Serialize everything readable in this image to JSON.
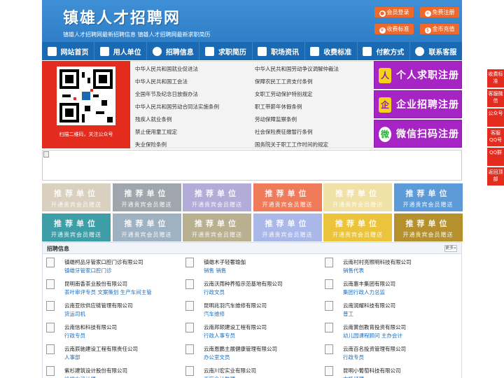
{
  "header": {
    "site_title": "镇雄人才招聘网",
    "tagline": "镇雄人才招聘网最新招聘信息    镇雄人才招聘网最新求职简历",
    "buttons": [
      {
        "label": "会员登录",
        "icon": "user-icon"
      },
      {
        "label": "免费注册",
        "icon": "register-icon"
      },
      {
        "label": "收费标准",
        "icon": "price-icon"
      },
      {
        "label": "金币充值",
        "icon": "coin-icon"
      }
    ]
  },
  "nav": {
    "items": [
      {
        "label": "网站首页",
        "icon": "home-icon"
      },
      {
        "label": "用人单位",
        "icon": "building-icon"
      },
      {
        "label": "招聘信息",
        "icon": "megaphone-icon"
      },
      {
        "label": "求职简历",
        "icon": "resume-icon"
      },
      {
        "label": "职场资讯",
        "icon": "news-icon"
      },
      {
        "label": "收费标准",
        "icon": "price-icon"
      },
      {
        "label": "付款方式",
        "icon": "card-icon"
      },
      {
        "label": "联系客服",
        "icon": "phone-icon"
      }
    ]
  },
  "qr": {
    "caption": "扫描二维码，关注公众号"
  },
  "links": {
    "left": [
      "中华人民共和国就业促进法",
      "中华人民共和国工会法",
      "全国年节及纪念日放假办法",
      "中华人民共和国劳动合同法实施条例",
      "残疾人就业条例",
      "禁止使用童工规定",
      "失业保险条例"
    ],
    "right": [
      "中华人民共和国劳动争议调解仲裁法",
      "保障农民工工资支付条例",
      "女职工劳动保护特别规定",
      "职工带薪年休假条例",
      "劳动保障监察条例",
      "社会保险费征缴暂行条例",
      "国务院关于职工工作时间的规定"
    ]
  },
  "big_buttons": [
    {
      "label": "个人求职注册",
      "icon": "person-icon",
      "color": "#a624c4"
    },
    {
      "label": "企业招聘注册",
      "icon": "enterprise-icon",
      "color": "#a624c4"
    },
    {
      "label": "微信扫码注册",
      "icon": "wechat-icon",
      "color": "#a624c4"
    }
  ],
  "recommend": {
    "line1": "推荐单位",
    "line2": "开通贵宾会员赠送",
    "colors": [
      "#d9d0c0",
      "#9fa6ad",
      "#b3acd9",
      "#f07b5b",
      "#f0e1a6",
      "#5d9bd8",
      "#3d9ea8",
      "#9fb2c2",
      "#b8b08f",
      "#a9b8e8",
      "#ecc43c",
      "#b5912e"
    ]
  },
  "jobs": {
    "title": "招聘信息",
    "more": "更多»",
    "items": [
      {
        "company": "镇雄柯品牙管家口腔门诊有限公司",
        "positions": "镇雄牙管家口腔门诊"
      },
      {
        "company": "镇雄木子轻奢瑜伽",
        "positions": "销售 销售"
      },
      {
        "company": "云南村村亮照明科技有限公司",
        "positions": "销售代表"
      },
      {
        "company": "昆明南香茶业股份有限公司",
        "positions": "茶叶审评专员 文案策划 生产车间主管"
      },
      {
        "company": "云南沃雨种养殖示范基地有限公司",
        "positions": "行政文员"
      },
      {
        "company": "云南惠丰集团有限公司",
        "positions": "集团行政人力总监"
      },
      {
        "company": "云南亚欣供应链管理有限公司",
        "positions": "货运司机"
      },
      {
        "company": "昆明兆羽汽车维修有限公司",
        "positions": "汽车维修"
      },
      {
        "company": "云南润耀科技有限公司",
        "positions": "普工"
      },
      {
        "company": "云南信和科技有限公司",
        "positions": "行政专员"
      },
      {
        "company": "云南邦颉建设工程有限公司",
        "positions": "行政人事专员"
      },
      {
        "company": "云南黉创教育投资有限公司",
        "positions": "幼儿园课程顾问 主办会计"
      },
      {
        "company": "云南辰驰建设工程有限责任公司",
        "positions": "人事部"
      },
      {
        "company": "云南恩鹏主展健康管理有限公司",
        "positions": "办公室文员"
      },
      {
        "company": "云南百名投资管理有限公司",
        "positions": "行政专员"
      },
      {
        "company": "紫杉建筑设计股份有限公司",
        "positions": "给排水设计师"
      },
      {
        "company": "云南川宏实业有限公司",
        "positions": "工厂会计助理"
      },
      {
        "company": "昆明小葡萄科技有限公司",
        "positions": "市场经理"
      }
    ]
  },
  "float_bar": [
    "收费标准",
    "客服微信",
    "公众号",
    "客服QQ号",
    "QQ群",
    "返回顶部"
  ]
}
